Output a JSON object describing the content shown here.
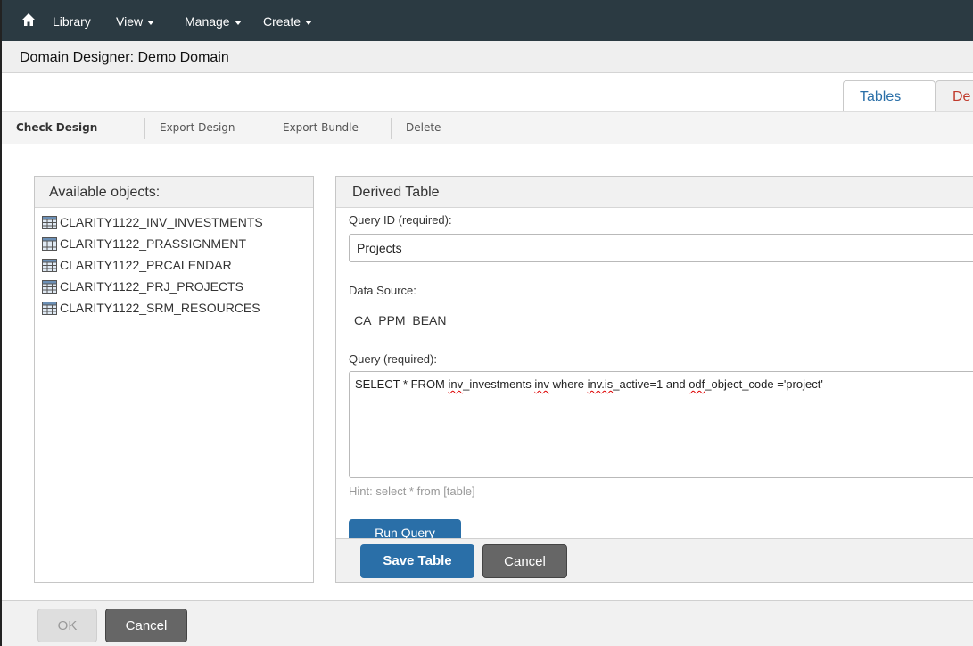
{
  "nav": {
    "home_icon": "home-icon",
    "items": [
      "Library",
      "View",
      "Manage",
      "Create"
    ]
  },
  "title": "Domain Designer: Demo Domain",
  "tabs": [
    "Tables",
    "De"
  ],
  "toolbar": [
    "Check Design",
    "Export Design",
    "Export Bundle",
    "Delete"
  ],
  "available_objects": {
    "heading": "Available objects:",
    "items": [
      "CLARITY1122_INV_INVESTMENTS",
      "CLARITY1122_PRASSIGNMENT",
      "CLARITY1122_PRCALENDAR",
      "CLARITY1122_PRJ_PROJECTS",
      "CLARITY1122_SRM_RESOURCES"
    ]
  },
  "derived_table": {
    "heading": "Derived Table",
    "query_id_label": "Query ID (required):",
    "query_id_value": "Projects",
    "data_source_label": "Data Source:",
    "data_source_value": "CA_PPM_BEAN",
    "query_label": "Query (required):",
    "query_parts": [
      "SELECT  *  FROM ",
      "inv",
      "_investments ",
      "inv",
      " where ",
      "inv.is",
      "_active=1 and ",
      "odf",
      "_object_code ='project'"
    ],
    "hint": "Hint: select * from [table]",
    "run_query_label": "Run Query",
    "save_label": "Save Table",
    "cancel_label": "Cancel"
  },
  "footer": {
    "ok_label": "OK",
    "cancel_label": "Cancel"
  },
  "colors": {
    "nav_bg": "#2b3a42",
    "primary": "#2a6fa8",
    "active_tab_text": "#c0392b"
  }
}
